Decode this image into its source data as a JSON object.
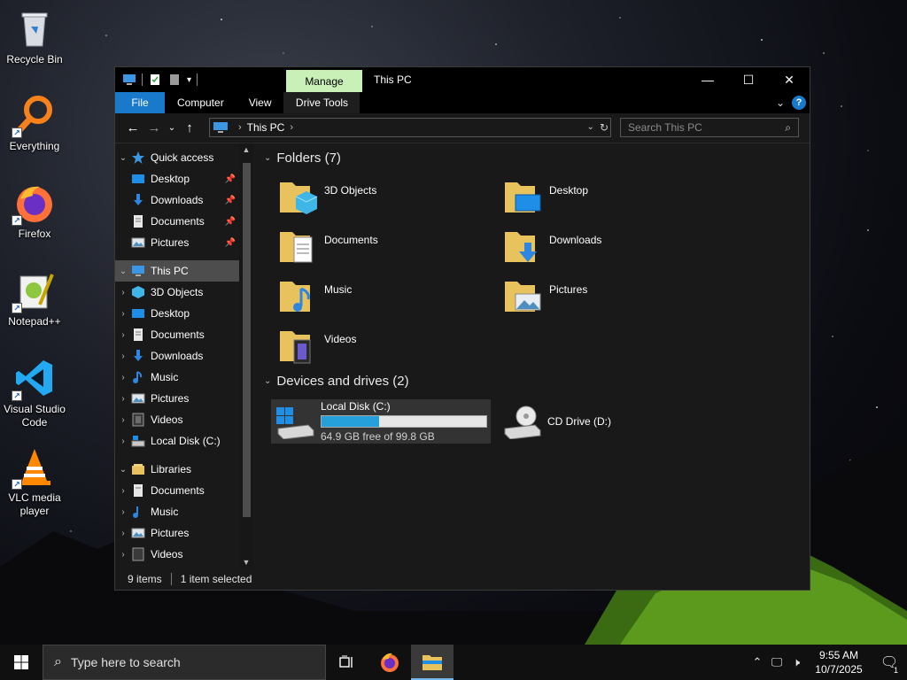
{
  "desktop": {
    "icons": [
      {
        "label": "Recycle Bin",
        "icon": "recycle-bin-icon"
      },
      {
        "label": "Everything",
        "icon": "everything-search-icon"
      },
      {
        "label": "Firefox",
        "icon": "firefox-icon"
      },
      {
        "label": "Notepad++",
        "icon": "notepadpp-icon"
      },
      {
        "label": "Visual Studio Code",
        "icon": "vscode-icon"
      },
      {
        "label": "VLC media player",
        "icon": "vlc-icon"
      }
    ]
  },
  "window": {
    "title": "This PC",
    "manage_tab": "Manage",
    "tabs": {
      "file": "File",
      "computer": "Computer",
      "view": "View",
      "drive_tools": "Drive Tools"
    },
    "address": {
      "location": "This PC",
      "search_placeholder": "Search This PC"
    },
    "nav": {
      "quick_access": "Quick access",
      "quick_items": [
        "Desktop",
        "Downloads",
        "Documents",
        "Pictures"
      ],
      "this_pc": "This PC",
      "pc_items": [
        "3D Objects",
        "Desktop",
        "Documents",
        "Downloads",
        "Music",
        "Pictures",
        "Videos",
        "Local Disk (C:)"
      ],
      "libraries": "Libraries",
      "lib_items": [
        "Documents",
        "Music",
        "Pictures",
        "Videos"
      ]
    },
    "content": {
      "folders_header": "Folders (7)",
      "folders": [
        "3D Objects",
        "Desktop",
        "Documents",
        "Downloads",
        "Music",
        "Pictures",
        "Videos"
      ],
      "devices_header": "Devices and drives (2)",
      "drives": [
        {
          "name": "Local Disk (C:)",
          "free_text": "64.9 GB free of 99.8 GB",
          "used_fraction": 0.35
        },
        {
          "name": "CD Drive (D:)"
        }
      ]
    },
    "status": {
      "item_count": "9 items",
      "selection": "1 item selected"
    }
  },
  "taskbar": {
    "search_placeholder": "Type here to search",
    "time": "9:55 AM",
    "date": "10/7/2025",
    "notification_count": "1"
  },
  "colors": {
    "accent": "#1979ca",
    "manage_tab": "#c9f0b6",
    "drive_bar": "#26a0da"
  }
}
